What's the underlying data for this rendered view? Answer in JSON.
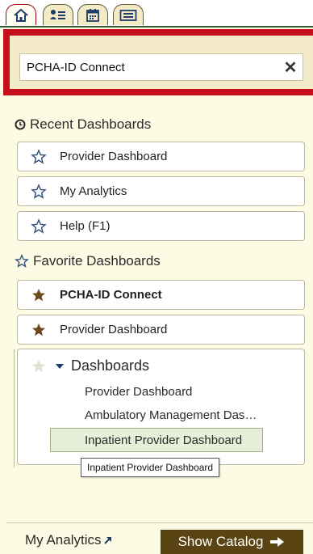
{
  "tabs": [
    {
      "icon": "home-icon",
      "active": true
    },
    {
      "icon": "list-icon",
      "active": false
    },
    {
      "icon": "calendar-icon",
      "active": false
    },
    {
      "icon": "inbox-icon",
      "active": false
    }
  ],
  "search": {
    "value": "PCHA-ID Connect",
    "clear_label": "✕"
  },
  "recent": {
    "heading": "Recent Dashboards",
    "heading_icon": "clock-icon",
    "items": [
      {
        "label": "Provider Dashboard",
        "starred": false
      },
      {
        "label": "My Analytics",
        "starred": false
      },
      {
        "label": "Help (F1)",
        "starred": false
      }
    ]
  },
  "favorites": {
    "heading": "Favorite Dashboards",
    "heading_icon": "star-outline-icon",
    "items": [
      {
        "label": "PCHA-ID Connect",
        "starred": true,
        "bold": true
      },
      {
        "label": "Provider Dashboard",
        "starred": true,
        "bold": false
      }
    ],
    "folder": {
      "label": "Dashboards",
      "expanded": true,
      "children": [
        {
          "label": "Provider Dashboard",
          "selected": false
        },
        {
          "label": "Ambulatory Management Das…",
          "selected": false
        },
        {
          "label": "Inpatient Provider Dashboard",
          "selected": true
        }
      ]
    }
  },
  "tooltip": {
    "text": "Inpatient Provider Dashboard"
  },
  "footer": {
    "my_analytics_label": "My Analytics",
    "show_catalog_label": "Show Catalog"
  },
  "colors": {
    "background": "#fdfbe3",
    "search_frame": "#c5101b",
    "filled_star": "#6b4a1b",
    "outline_star": "#2e4f7a",
    "catalog_button": "#5a4413"
  }
}
